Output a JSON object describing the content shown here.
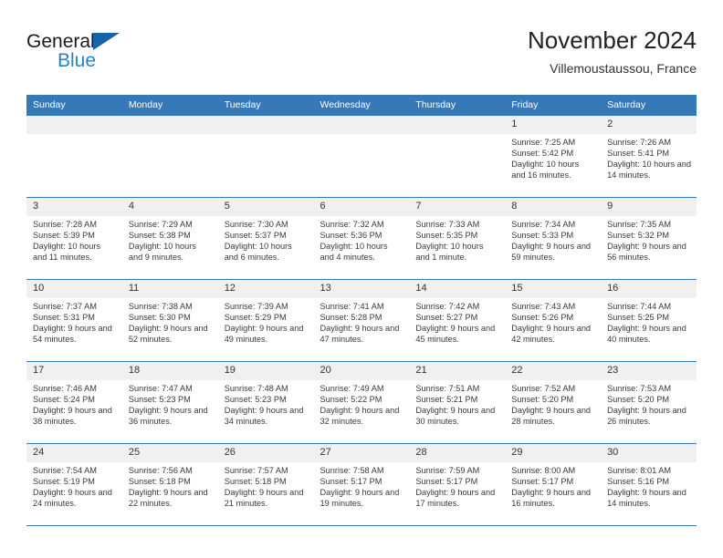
{
  "brand": {
    "line1": "General",
    "line2": "Blue",
    "triangle_color": "#1565a8",
    "blue_text_color": "#2083cc"
  },
  "header": {
    "title": "November 2024",
    "subtitle": "Villemoustaussou, France"
  },
  "theme": {
    "header_band": "#3579b8",
    "date_band": "#f0f0f0",
    "row_border": "#3579b8"
  },
  "weekdays": [
    "Sunday",
    "Monday",
    "Tuesday",
    "Wednesday",
    "Thursday",
    "Friday",
    "Saturday"
  ],
  "labels": {
    "sunrise_prefix": "Sunrise:",
    "sunset_prefix": "Sunset:",
    "daylight_prefix": "Daylight:"
  },
  "weeks": [
    [
      {
        "date": "",
        "empty": true
      },
      {
        "date": "",
        "empty": true
      },
      {
        "date": "",
        "empty": true
      },
      {
        "date": "",
        "empty": true
      },
      {
        "date": "",
        "empty": true
      },
      {
        "date": "1",
        "sunrise": "Sunrise: 7:25 AM",
        "sunset": "Sunset: 5:42 PM",
        "daylight": "Daylight: 10 hours and 16 minutes."
      },
      {
        "date": "2",
        "sunrise": "Sunrise: 7:26 AM",
        "sunset": "Sunset: 5:41 PM",
        "daylight": "Daylight: 10 hours and 14 minutes."
      }
    ],
    [
      {
        "date": "3",
        "sunrise": "Sunrise: 7:28 AM",
        "sunset": "Sunset: 5:39 PM",
        "daylight": "Daylight: 10 hours and 11 minutes."
      },
      {
        "date": "4",
        "sunrise": "Sunrise: 7:29 AM",
        "sunset": "Sunset: 5:38 PM",
        "daylight": "Daylight: 10 hours and 9 minutes."
      },
      {
        "date": "5",
        "sunrise": "Sunrise: 7:30 AM",
        "sunset": "Sunset: 5:37 PM",
        "daylight": "Daylight: 10 hours and 6 minutes."
      },
      {
        "date": "6",
        "sunrise": "Sunrise: 7:32 AM",
        "sunset": "Sunset: 5:36 PM",
        "daylight": "Daylight: 10 hours and 4 minutes."
      },
      {
        "date": "7",
        "sunrise": "Sunrise: 7:33 AM",
        "sunset": "Sunset: 5:35 PM",
        "daylight": "Daylight: 10 hours and 1 minute."
      },
      {
        "date": "8",
        "sunrise": "Sunrise: 7:34 AM",
        "sunset": "Sunset: 5:33 PM",
        "daylight": "Daylight: 9 hours and 59 minutes."
      },
      {
        "date": "9",
        "sunrise": "Sunrise: 7:35 AM",
        "sunset": "Sunset: 5:32 PM",
        "daylight": "Daylight: 9 hours and 56 minutes."
      }
    ],
    [
      {
        "date": "10",
        "sunrise": "Sunrise: 7:37 AM",
        "sunset": "Sunset: 5:31 PM",
        "daylight": "Daylight: 9 hours and 54 minutes."
      },
      {
        "date": "11",
        "sunrise": "Sunrise: 7:38 AM",
        "sunset": "Sunset: 5:30 PM",
        "daylight": "Daylight: 9 hours and 52 minutes."
      },
      {
        "date": "12",
        "sunrise": "Sunrise: 7:39 AM",
        "sunset": "Sunset: 5:29 PM",
        "daylight": "Daylight: 9 hours and 49 minutes."
      },
      {
        "date": "13",
        "sunrise": "Sunrise: 7:41 AM",
        "sunset": "Sunset: 5:28 PM",
        "daylight": "Daylight: 9 hours and 47 minutes."
      },
      {
        "date": "14",
        "sunrise": "Sunrise: 7:42 AM",
        "sunset": "Sunset: 5:27 PM",
        "daylight": "Daylight: 9 hours and 45 minutes."
      },
      {
        "date": "15",
        "sunrise": "Sunrise: 7:43 AM",
        "sunset": "Sunset: 5:26 PM",
        "daylight": "Daylight: 9 hours and 42 minutes."
      },
      {
        "date": "16",
        "sunrise": "Sunrise: 7:44 AM",
        "sunset": "Sunset: 5:25 PM",
        "daylight": "Daylight: 9 hours and 40 minutes."
      }
    ],
    [
      {
        "date": "17",
        "sunrise": "Sunrise: 7:46 AM",
        "sunset": "Sunset: 5:24 PM",
        "daylight": "Daylight: 9 hours and 38 minutes."
      },
      {
        "date": "18",
        "sunrise": "Sunrise: 7:47 AM",
        "sunset": "Sunset: 5:23 PM",
        "daylight": "Daylight: 9 hours and 36 minutes."
      },
      {
        "date": "19",
        "sunrise": "Sunrise: 7:48 AM",
        "sunset": "Sunset: 5:23 PM",
        "daylight": "Daylight: 9 hours and 34 minutes."
      },
      {
        "date": "20",
        "sunrise": "Sunrise: 7:49 AM",
        "sunset": "Sunset: 5:22 PM",
        "daylight": "Daylight: 9 hours and 32 minutes."
      },
      {
        "date": "21",
        "sunrise": "Sunrise: 7:51 AM",
        "sunset": "Sunset: 5:21 PM",
        "daylight": "Daylight: 9 hours and 30 minutes."
      },
      {
        "date": "22",
        "sunrise": "Sunrise: 7:52 AM",
        "sunset": "Sunset: 5:20 PM",
        "daylight": "Daylight: 9 hours and 28 minutes."
      },
      {
        "date": "23",
        "sunrise": "Sunrise: 7:53 AM",
        "sunset": "Sunset: 5:20 PM",
        "daylight": "Daylight: 9 hours and 26 minutes."
      }
    ],
    [
      {
        "date": "24",
        "sunrise": "Sunrise: 7:54 AM",
        "sunset": "Sunset: 5:19 PM",
        "daylight": "Daylight: 9 hours and 24 minutes."
      },
      {
        "date": "25",
        "sunrise": "Sunrise: 7:56 AM",
        "sunset": "Sunset: 5:18 PM",
        "daylight": "Daylight: 9 hours and 22 minutes."
      },
      {
        "date": "26",
        "sunrise": "Sunrise: 7:57 AM",
        "sunset": "Sunset: 5:18 PM",
        "daylight": "Daylight: 9 hours and 21 minutes."
      },
      {
        "date": "27",
        "sunrise": "Sunrise: 7:58 AM",
        "sunset": "Sunset: 5:17 PM",
        "daylight": "Daylight: 9 hours and 19 minutes."
      },
      {
        "date": "28",
        "sunrise": "Sunrise: 7:59 AM",
        "sunset": "Sunset: 5:17 PM",
        "daylight": "Daylight: 9 hours and 17 minutes."
      },
      {
        "date": "29",
        "sunrise": "Sunrise: 8:00 AM",
        "sunset": "Sunset: 5:17 PM",
        "daylight": "Daylight: 9 hours and 16 minutes."
      },
      {
        "date": "30",
        "sunrise": "Sunrise: 8:01 AM",
        "sunset": "Sunset: 5:16 PM",
        "daylight": "Daylight: 9 hours and 14 minutes."
      }
    ]
  ]
}
